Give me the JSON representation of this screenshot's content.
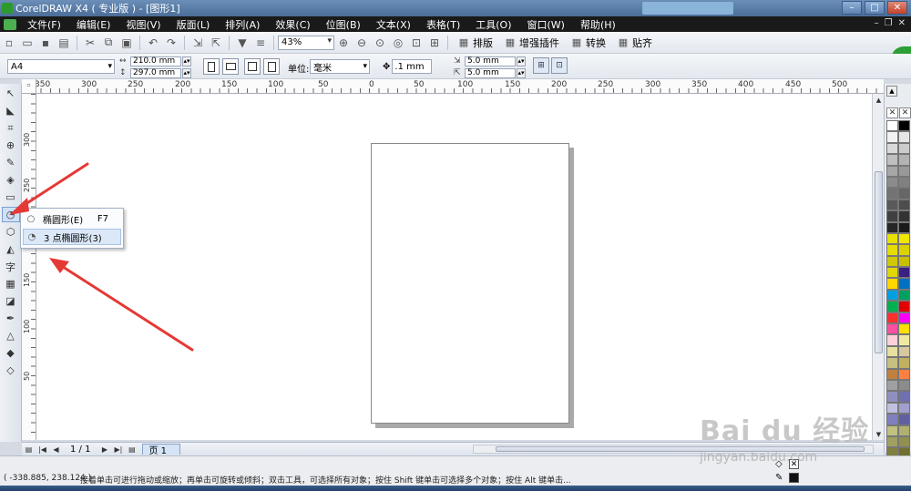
{
  "window": {
    "title": "CorelDRAW X4 ( 专业版 ) - [图形1]",
    "min": "–",
    "max": "□",
    "close": "✕"
  },
  "menu": [
    "文件(F)",
    "编辑(E)",
    "视图(V)",
    "版面(L)",
    "排列(A)",
    "效果(C)",
    "位图(B)",
    "文本(X)",
    "表格(T)",
    "工具(O)",
    "窗口(W)",
    "帮助(H)"
  ],
  "toolbar": {
    "zoom": "43%",
    "btn_layout": "排版",
    "btn_plugin": "增强插件",
    "btn_convert": "转换",
    "btn_paste": "贴齐"
  },
  "badge": "82",
  "property_bar": {
    "paper": "A4",
    "width": "210.0 mm",
    "height": "297.0 mm",
    "unit_label": "单位:",
    "unit": "毫米",
    "nudge": ".1 mm",
    "dup_x": "5.0 mm",
    "dup_y": "5.0 mm"
  },
  "ruler_h_labels": [
    "350",
    "300",
    "250",
    "200",
    "150",
    "100",
    "50",
    "0",
    "50",
    "100",
    "150",
    "200",
    "250",
    "300",
    "350",
    "400",
    "450",
    "500"
  ],
  "ruler_v_labels": [
    "300",
    "250",
    "200",
    "150",
    "100",
    "50"
  ],
  "flyout": {
    "items": [
      {
        "label": "椭圆形(E)",
        "shortcut": "F7",
        "icon": "ellipse-icon"
      },
      {
        "label": "3 点椭圆形(3)",
        "shortcut": "",
        "icon": "three-point-ellipse-icon"
      }
    ]
  },
  "page_nav": {
    "counter": "1 / 1",
    "tab": "页 1"
  },
  "status": {
    "coords": "( -338.885, 238.124 )",
    "hint": "接着单击可进行拖动或缩放；再单击可旋转或倾斜；双击工具，可选择所有对象；按住 Shift 键单击可选择多个对象；按住 Alt 键单击..."
  },
  "palette_colors": [
    "#ffffff",
    "#000000",
    "#f2f2f2",
    "#e6e6e6",
    "#d9d9d9",
    "#cccccc",
    "#bfbfbf",
    "#b3b3b3",
    "#a6a6a6",
    "#999999",
    "#8c8c8c",
    "#808080",
    "#737373",
    "#666666",
    "#595959",
    "#4d4d4d",
    "#404040",
    "#333333",
    "#262626",
    "#1a1a1a",
    "#e8e000",
    "#f0e600",
    "#e6dc00",
    "#dcd200",
    "#d0c800",
    "#c8c000",
    "#e0d800",
    "#3a2080",
    "#ffd800",
    "#0070c0",
    "#00a0e0",
    "#00a060",
    "#00b050",
    "#e00000",
    "#ff3030",
    "#ff00ff",
    "#ff50a0",
    "#ffe000",
    "#ffd0d8",
    "#f0e8a0",
    "#e8e0a0",
    "#d8c8a0",
    "#c8c080",
    "#c0b060",
    "#c08040",
    "#ff8040",
    "#a0a0a0",
    "#8c8c8c",
    "#9090c0",
    "#7070b0",
    "#c0c0e0",
    "#a0a0d0",
    "#8080c0",
    "#6060a0",
    "#c0c080",
    "#b0b070",
    "#a0a060",
    "#909050",
    "#808040",
    "#707030"
  ],
  "watermark": {
    "brand": "Bai du 经验",
    "url": "jingyan.baidu.com"
  }
}
